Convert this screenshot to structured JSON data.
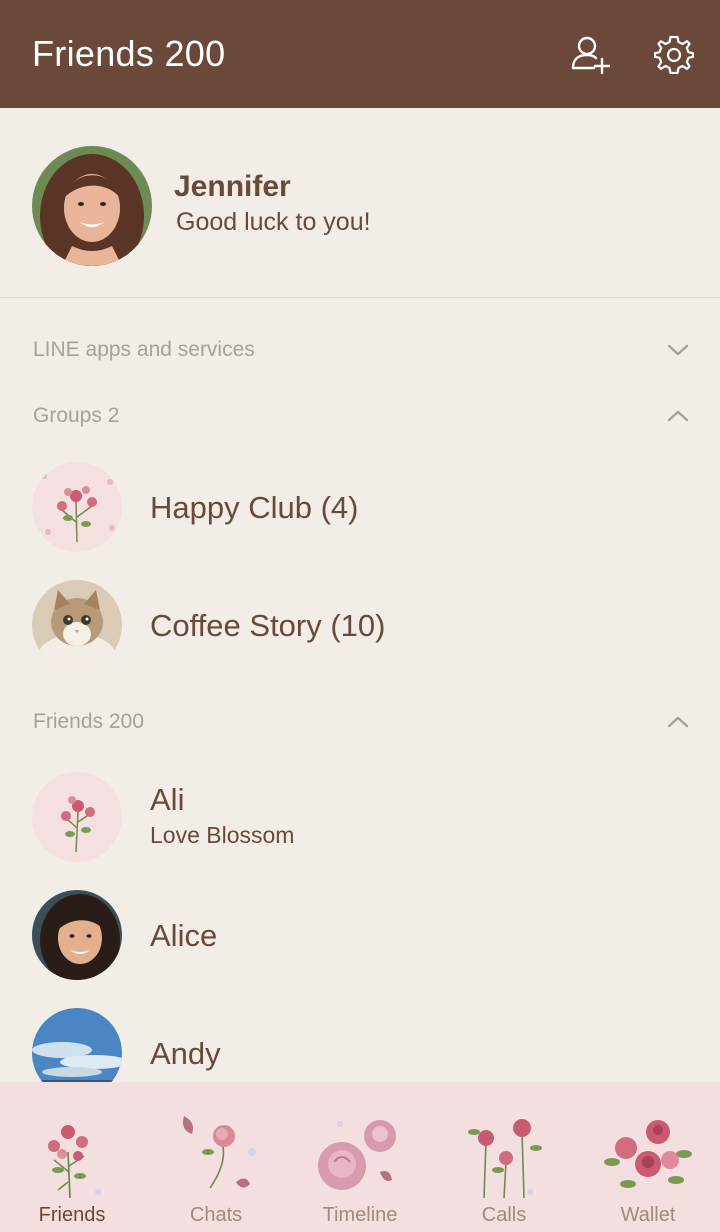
{
  "header": {
    "title": "Friends 200",
    "add_friend_icon": "add-friend-icon",
    "settings_icon": "gear-icon",
    "bg_color": "#6b493a"
  },
  "profile": {
    "name": "Jennifer",
    "status": "Good luck to you!"
  },
  "sections": {
    "services": {
      "label": "LINE apps and services",
      "state": "collapsed"
    },
    "groups": {
      "label": "Groups 2",
      "state": "expanded"
    },
    "friends": {
      "label": "Friends 200",
      "state": "expanded"
    }
  },
  "groups": [
    {
      "name": "Happy Club (4)",
      "avatar": "roses-pattern"
    },
    {
      "name": "Coffee Story (10)",
      "avatar": "cat-photo"
    }
  ],
  "friends": [
    {
      "name": "Ali",
      "status": "Love Blossom",
      "avatar": "rose-sticker"
    },
    {
      "name": "Alice",
      "status": "",
      "avatar": "woman-photo"
    },
    {
      "name": "Andy",
      "status": "",
      "avatar": "sky-photo"
    }
  ],
  "tabs": [
    {
      "label": "Friends",
      "active": true
    },
    {
      "label": "Chats",
      "active": false
    },
    {
      "label": "Timeline",
      "active": false
    },
    {
      "label": "Calls",
      "active": false
    },
    {
      "label": "Wallet",
      "active": false
    }
  ],
  "colors": {
    "accent": "#6b493a",
    "background": "#f2ede7",
    "tabbar": "#f3dfe0",
    "rose": "#d16b80"
  }
}
